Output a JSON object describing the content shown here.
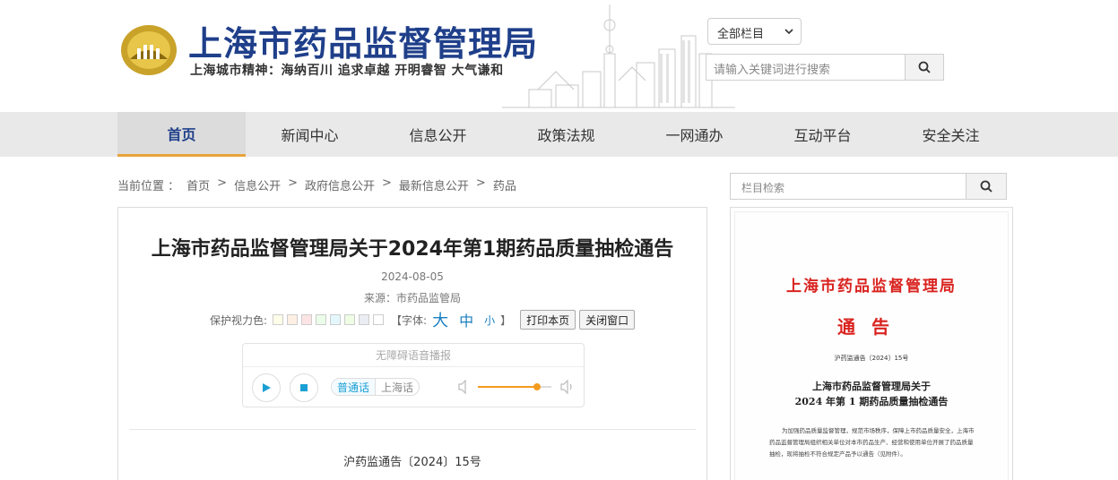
{
  "header": {
    "site_title": "上海市药品监督管理局",
    "slogan": "上海城市精神：海纳百川  追求卓越  开明睿智  大气谦和",
    "column_select": "全部栏目",
    "search_placeholder": "请输入关键词进行搜索"
  },
  "nav": {
    "items": [
      {
        "label": "首页"
      },
      {
        "label": "新闻中心"
      },
      {
        "label": "信息公开"
      },
      {
        "label": "政策法规"
      },
      {
        "label": "一网通办"
      },
      {
        "label": "互动平台"
      },
      {
        "label": "安全关注"
      }
    ]
  },
  "breadcrumb": {
    "prefix": "当前位置 ：",
    "items": [
      "首页",
      "信息公开",
      "政府信息公开",
      "最新信息公开",
      "药品"
    ],
    "separator": ">"
  },
  "article": {
    "title": "上海市药品监督管理局关于2024年第1期药品质量抽检通告",
    "date": "2024-08-05",
    "source": "来源：市药品监管局",
    "eye_care_label": "保护视力色:",
    "eye_care_colors": [
      "#fdfde8",
      "#fdefe4",
      "#fde4e4",
      "#eafde8",
      "#e4f7fd",
      "#eefde4",
      "#ececf4",
      "#ffffff"
    ],
    "font_label_open": "【字体:",
    "font_large": "大",
    "font_mid": "中",
    "font_small": "小",
    "font_label_close": "】",
    "print_button": "打印本页",
    "close_button": "关闭窗口",
    "doc_number": "沪药监通告〔2024〕15号"
  },
  "player": {
    "title": "无障碍语音播报",
    "lang_on": "普通话",
    "lang_off": "上海话",
    "volume_level": 0.8,
    "accent_color": "#f39b1f"
  },
  "sidebar": {
    "search_placeholder": "栏目检索"
  },
  "notice_doc": {
    "agency": "上海市药品监督管理局",
    "notice": "通告",
    "ref": "沪药监通告〔2024〕15号",
    "title_line1": "上海市药品监督管理局关于",
    "title_line2": "2024 年第 1 期药品质量抽检通告",
    "body": "为加强药品质量监督管理，规范市场秩序，保障上市药品质量安全，上海市药品监督管理局组织相关单位对本市药品生产、经营和使用单位开展了药品质量抽检，现将抽检不符合规定产品予以通告（见附件）。"
  },
  "colors": {
    "brand_blue": "#1f3f8a",
    "nav_bg": "#e9e9e9",
    "accent_orange": "#e8a33a",
    "doc_red": "#d9231f"
  }
}
